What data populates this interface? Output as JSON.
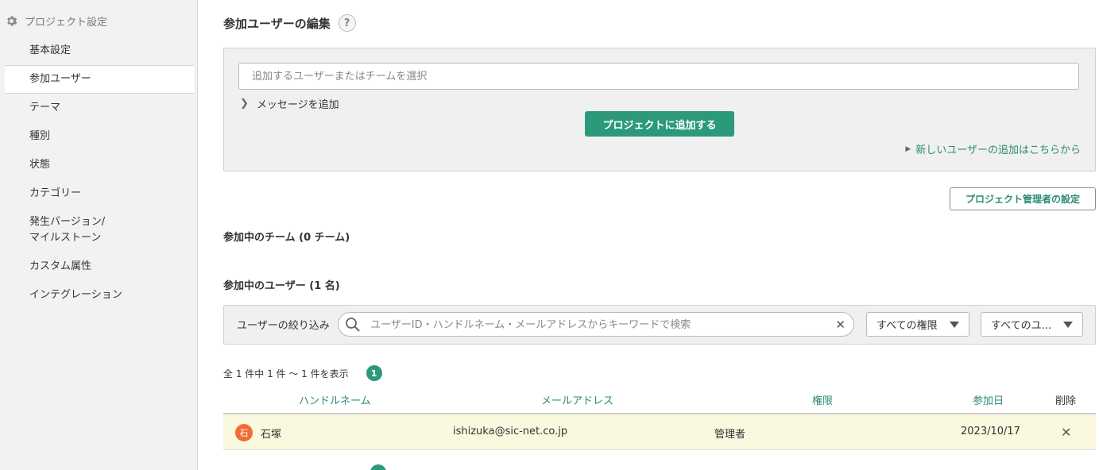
{
  "sidebar": {
    "heading": "プロジェクト設定",
    "items": [
      {
        "label": "基本設定"
      },
      {
        "label": "参加ユーザー"
      },
      {
        "label": "テーマ"
      },
      {
        "label": "種別"
      },
      {
        "label": "状態"
      },
      {
        "label": "カテゴリー"
      },
      {
        "label": "発生バージョン/"
      },
      {
        "label": "マイルストーン"
      },
      {
        "label": "カスタム属性"
      },
      {
        "label": "インテグレーション"
      }
    ],
    "active_item": "参加ユーザー"
  },
  "page": {
    "title": "参加ユーザーの編集",
    "help_glyph": "?"
  },
  "add_panel": {
    "user_placeholder": "追加するユーザーまたはチームを選択",
    "message_toggle": "メッセージを追加",
    "add_button": "プロジェクトに追加する",
    "new_user_link": "新しいユーザーの追加はこちらから"
  },
  "admin_button": "プロジェクト管理者の設定",
  "teams_heading": "参加中のチーム (0 チーム)",
  "users_heading": "参加中のユーザー (1 名)",
  "filter": {
    "label": "ユーザーの絞り込み",
    "search_placeholder": "ユーザーID・ハンドルネーム・メールアドレスからキーワードで検索",
    "role_select": "すべての権限",
    "type_select": "すべてのユ..."
  },
  "pagination": {
    "summary": "全 1 件中 1 件 ～ 1 件を表示",
    "page": "1"
  },
  "table": {
    "headers": {
      "handle": "ハンドルネーム",
      "email": "メールアドレス",
      "role": "権限",
      "joined": "参加日",
      "delete": "削除"
    },
    "rows": [
      {
        "avatar_char": "石",
        "handle": "石塚",
        "email": "ishizuka@sic-net.co.jp",
        "role": "管理者",
        "joined": "2023/10/17"
      }
    ]
  },
  "colors": {
    "accent": "#2c9a7a",
    "link": "#2c8a73",
    "highlight_row": "#fbf8e0",
    "avatar": "#f26b36"
  },
  "icons": {
    "sidebar_heading": "gear-icon",
    "help": "question-icon",
    "search": "search-icon",
    "clear": "close-icon",
    "delete": "close-icon"
  }
}
